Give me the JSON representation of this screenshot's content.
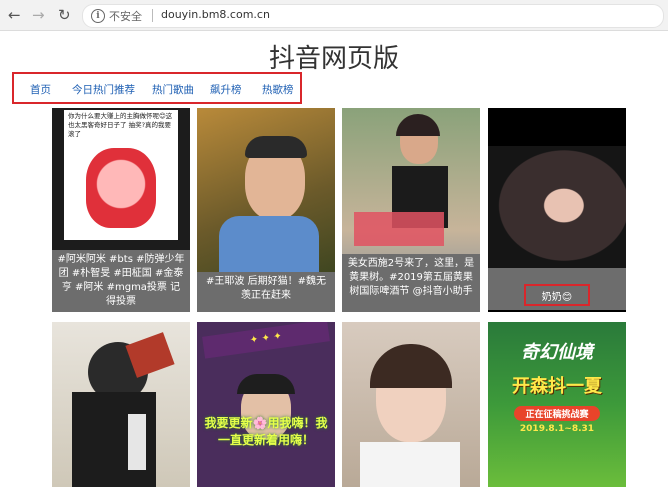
{
  "browser": {
    "back_icon": "arrow-left-icon",
    "forward_icon": "arrow-right-icon",
    "reload_icon": "reload-icon",
    "security_label": "不安全",
    "url": "douyin.bm8.com.cn"
  },
  "page": {
    "title": "抖音网页版",
    "nav": [
      "首页",
      "今日热门推荐",
      "热门歌曲",
      "飙升榜",
      "热歌榜"
    ]
  },
  "videos": [
    {
      "overlay": "你为什么要大赚上的主胸做怀呢😊这也太黑客奇好日子了 抽奖?真的我要滚了",
      "caption": "#阿米阿米 #bts #防弹少年团 #朴智旻 #田柾国 #金泰亨 #阿米 #mgma投票 记得投票"
    },
    {
      "overlay": "",
      "caption": "#王耶波 后期好猫！#魏无羡正在赶来"
    },
    {
      "overlay": "",
      "caption": "美女西施2号来了，这里，是黄果树。#2019第五届黄果树国际啤酒节 @抖音小助手"
    },
    {
      "overlay": "",
      "caption": "奶奶😊"
    },
    {
      "overlay": "",
      "caption": ""
    },
    {
      "overlay": "我要更新🌸用我嗨！我一直更新着用嗨！",
      "caption": ""
    },
    {
      "overlay": "",
      "caption": ""
    },
    {
      "overlay": "奇幻仙境",
      "overlay2": "开森抖一夏",
      "overlay3": "正在征稿挑战赛",
      "overlay4": "2019.8.1~8.31",
      "caption": ""
    }
  ],
  "colors": {
    "highlight": "#d9262b",
    "link": "#1e5fb3",
    "caption_bg": "#6d6d6d"
  }
}
